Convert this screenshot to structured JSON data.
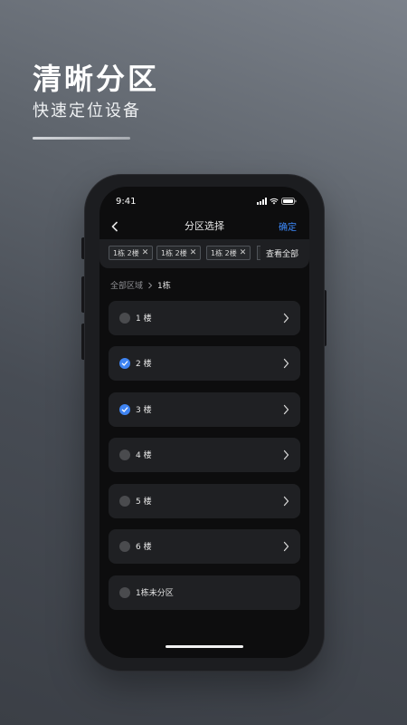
{
  "hero": {
    "title": "清晰分区",
    "subtitle": "快速定位设备"
  },
  "status_bar": {
    "time": "9:41",
    "icons": [
      "signal-icon",
      "wifi-icon",
      "battery-icon"
    ]
  },
  "nav": {
    "title": "分区选择",
    "confirm_label": "确定",
    "back_icon": "chevron-left-icon"
  },
  "selected_chips": [
    {
      "label": "1栋 2楼"
    },
    {
      "label": "1栋 2楼"
    },
    {
      "label": "1栋 2楼"
    }
  ],
  "view_all_label": "查看全部",
  "breadcrumb": {
    "root": "全部区域",
    "current": "1栋"
  },
  "floors": [
    {
      "label": "1 楼",
      "checked": false,
      "has_arrow": true
    },
    {
      "label": "2 楼",
      "checked": true,
      "has_arrow": true
    },
    {
      "label": "3 楼",
      "checked": true,
      "has_arrow": true
    },
    {
      "label": "4 楼",
      "checked": false,
      "has_arrow": true
    },
    {
      "label": "5 楼",
      "checked": false,
      "has_arrow": true
    },
    {
      "label": "6 楼",
      "checked": false,
      "has_arrow": true
    },
    {
      "label": "1栋未分区",
      "checked": false,
      "has_arrow": false
    }
  ],
  "colors": {
    "accent": "#3f84f2",
    "confirm": "#3d8bff"
  }
}
